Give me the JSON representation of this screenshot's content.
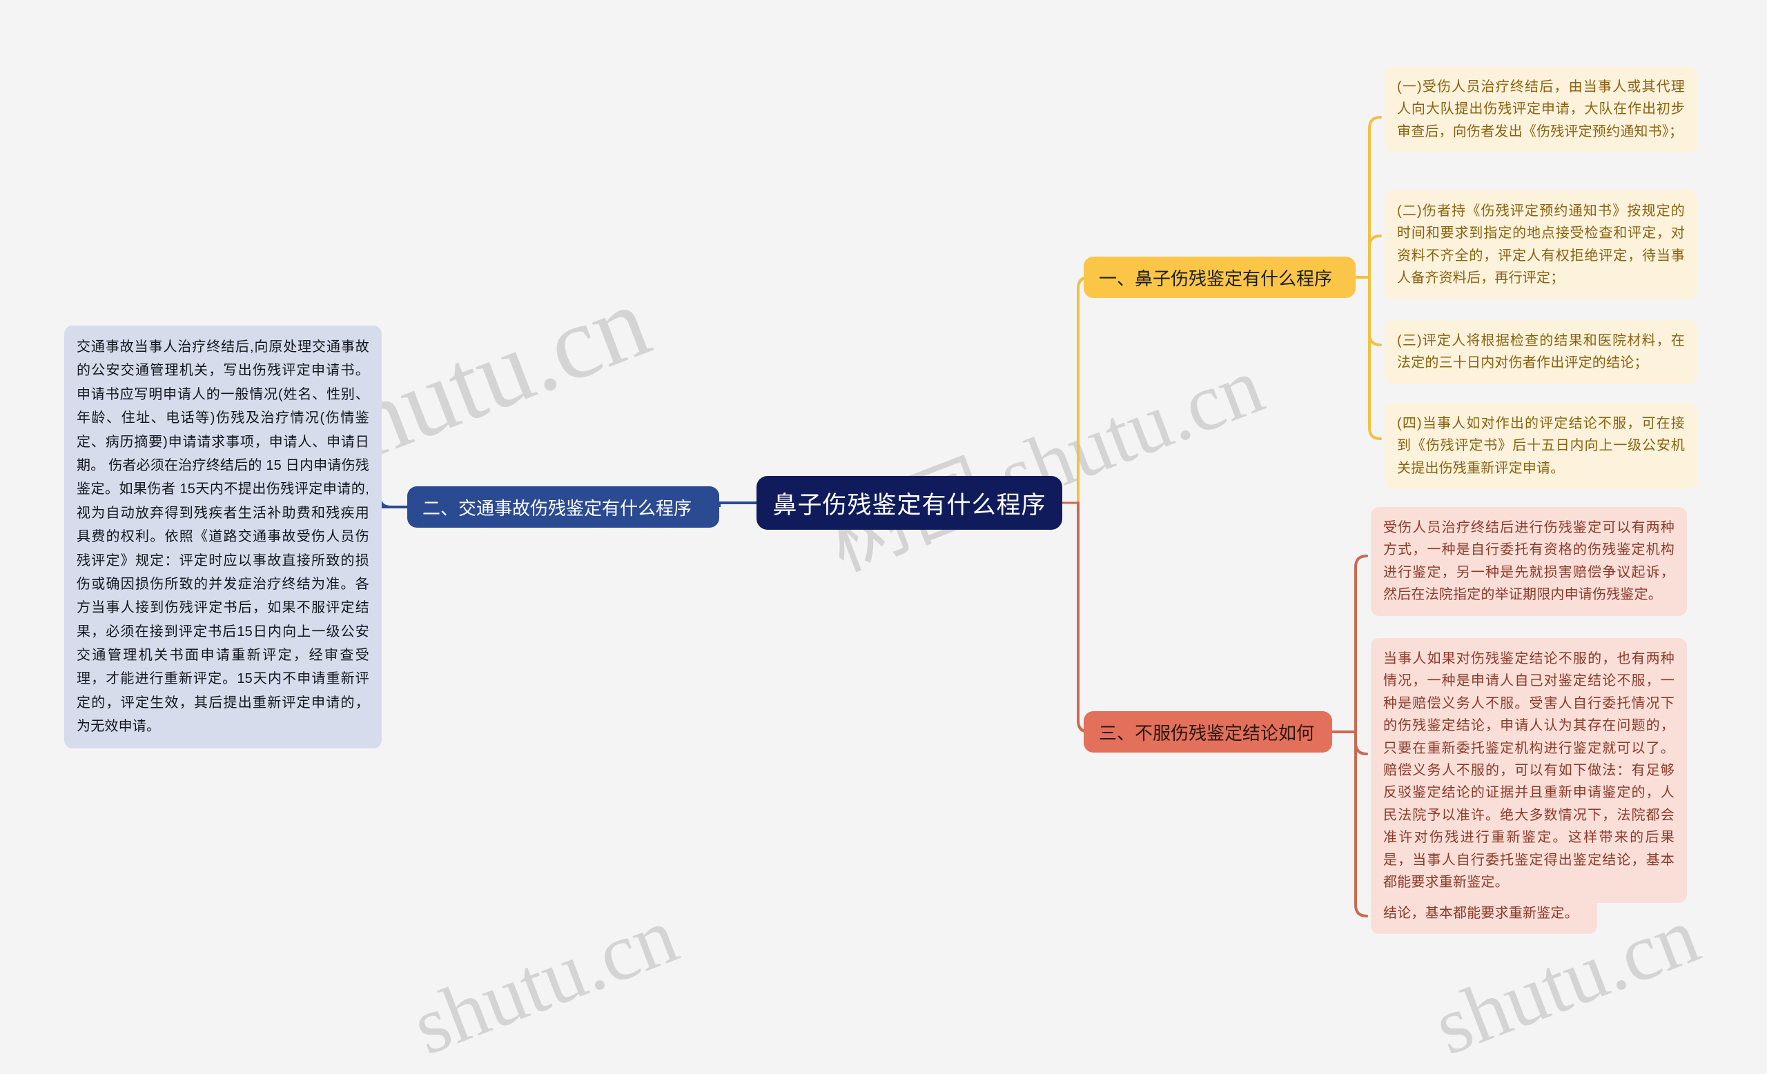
{
  "title": "鼻子伤残鉴定有什么程序",
  "background_color": "#f4f4f5",
  "root": {
    "label": "鼻子伤残鉴定有什么程序",
    "color": "#101b5c",
    "text_color": "#ffffff"
  },
  "branches": [
    {
      "id": "branch-1",
      "label": "一、鼻子伤残鉴定有什么程序",
      "color": "#fbc647",
      "line_color": "#f0c243",
      "side": "right",
      "leaves": [
        "(一)受伤人员治疗终结后，由当事人或其代理人向大队提出伤残评定申请，大队在作出初步审查后，向伤者发出《伤残评定预约通知书》；",
        "(二)伤者持《伤残评定预约通知书》按规定的时间和要求到指定的地点接受检查和评定，对资料不齐全的，评定人有权拒绝评定，待当事人备齐资料后，再行评定；",
        "(三)评定人将根据检查的结果和医院材料，在法定的三十日内对伤者作出评定的结论；",
        "(四)当事人如对作出的评定结论不服，可在接到《伤残评定书》后十五日内向上一级公安机关提出伤残重新评定申请。"
      ]
    },
    {
      "id": "branch-2",
      "label": "二、交通事故伤残鉴定有什么程序",
      "color": "#2a4a92",
      "line_color": "#2a4a92",
      "side": "left",
      "leaves": [
        "交通事故当事人治疗终结后,向原处理交通事故的公安交通管理机关，写出伤残评定申请书。申请书应写明申请人的一般情况(姓名、性别、年龄、住址、电话等)伤残及治疗情况(伤情鉴定、病历摘要)申请请求事项，申请人、申请日期。 伤者必须在治疗终结后的 15 日内申请伤残鉴定。如果伤者 15天内不提出伤残评定申请的,视为自动放弃得到残疾者生活补助费和残疾用具费的权利。依照《道路交通事故受伤人员伤残评定》规定：评定时应以事故直接所致的损伤或确因损伤所致的并发症治疗终结为准。各方当事人接到伤残评定书后，如果不服评定结果，必须在接到评定书后15日内向上一级公安交通管理机关书面申请重新评定，经审查受理，才能进行重新评定。15天内不申请重新评定的，评定生效，其后提出重新评定申请的，为无效申请。"
      ]
    },
    {
      "id": "branch-3",
      "label": "三、不服伤残鉴定结论如何",
      "color": "#e2705a",
      "line_color": "#c96a51",
      "side": "right",
      "leaves": [
        "受伤人员治疗终结后进行伤残鉴定可以有两种方式，一种是自行委托有资格的伤残鉴定机构进行鉴定，另一种是先就损害赔偿争议起诉，然后在法院指定的举证期限内申请伤残鉴定。",
        "当事人如果对伤残鉴定结论不服的，也有两种情况，一种是申请人自己对鉴定结论不服，一种是赔偿义务人不服。受害人自行委托情况下的伤残鉴定结论，申请人认为其存在问题的，只要在重新委托鉴定机构进行鉴定就可以了。赔偿义务人不服的，可以有如下做法：有足够反驳鉴定结论的证据并且重新申请鉴定的，人民法院予以准许。绝大多数情况下，法院都会准许对伤残进行重新鉴定。这样带来的后果是，当事人自行委托鉴定得出鉴定结论，基本都能要求重新鉴定。",
        "结论，基本都能要求重新鉴定。"
      ]
    }
  ],
  "watermarks": [
    "shutu.cn",
    "树图 shutu.cn",
    "shutu.cn",
    "shutu.cn"
  ]
}
